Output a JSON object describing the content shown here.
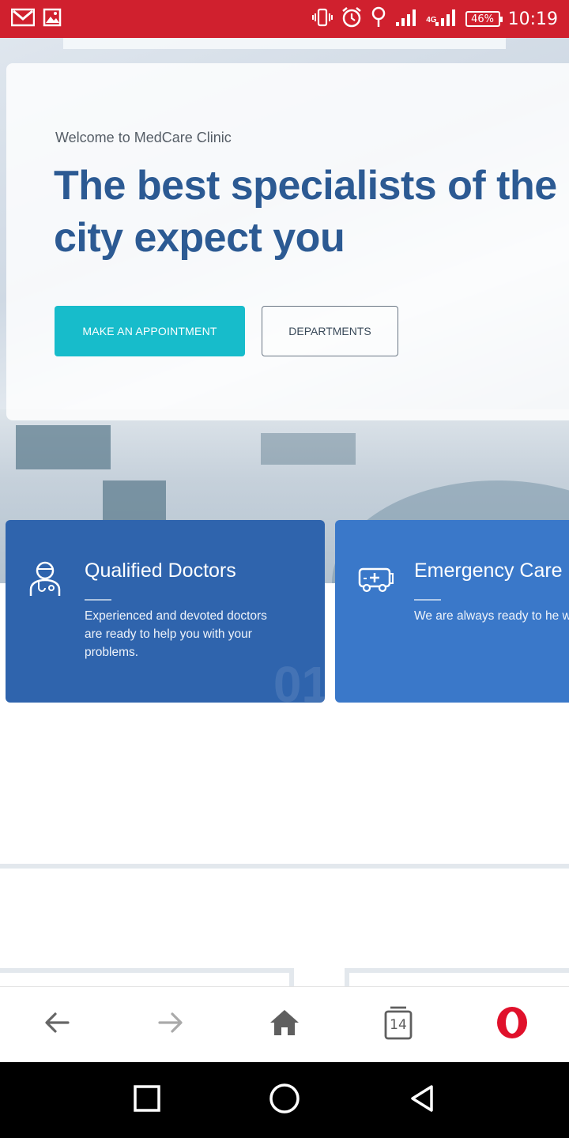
{
  "status_bar": {
    "time": "10:19",
    "battery": "46%",
    "network": "4G",
    "icons": [
      "gmail-icon",
      "gallery-icon",
      "vibrate-icon",
      "alarm-icon",
      "location-icon",
      "signal-icon",
      "signal-4g-icon",
      "battery-icon"
    ]
  },
  "hero": {
    "welcome": "Welcome to MedCare Clinic",
    "title": "The best specialists of the city expect you",
    "primary_button": "MAKE AN APPOINTMENT",
    "secondary_button": "DEPARTMENTS"
  },
  "features": [
    {
      "icon": "doctor-icon",
      "title": "Qualified Doctors",
      "text": "Experienced and devoted doctors\nare ready to help you with your\nproblems.",
      "number": "01"
    },
    {
      "icon": "ambulance-icon",
      "title": "Emergency Care",
      "text": "We are always ready to he\nwhen you need urgent hel\nemergency team is here fo"
    }
  ],
  "browser_bar": {
    "tab_count": "14",
    "icons": [
      "back-arrow-icon",
      "forward-arrow-icon",
      "home-icon",
      "tabs-icon",
      "opera-icon"
    ]
  },
  "android_nav": {
    "icons": [
      "recents-icon",
      "home-circle-icon",
      "back-triangle-icon"
    ]
  },
  "colors": {
    "status_bar": "#d0202e",
    "title_blue": "#2c5a93",
    "primary_button": "#17bccb",
    "card_1": "#2f64ad",
    "card_2": "#3a78c9",
    "opera_red": "#e0112b"
  }
}
